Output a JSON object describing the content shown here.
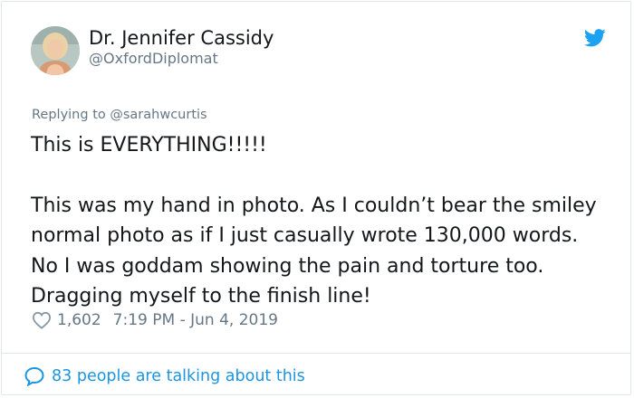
{
  "author": {
    "name": "Dr. Jennifer Cassidy",
    "handle": "@OxfordDiplomat"
  },
  "icons": {
    "brand": "twitter-bird-icon",
    "like": "heart-icon",
    "conversation": "speech-bubble-icon"
  },
  "colors": {
    "brand": "#1da1f2",
    "link": "#1b95e0",
    "secondary_text": "#657786",
    "border": "#e1e8ed"
  },
  "reply": {
    "prefix": "Replying to",
    "mention": "@sarahwcurtis"
  },
  "tweet": {
    "line1": "This is EVERYTHING!!!!!",
    "line2": "This was my hand in photo. As I couldn’t bear the smiley normal photo as if I just casually wrote 130,000 words. No I was goddam showing the pain and torture too. Dragging myself to the finish line!"
  },
  "meta": {
    "likes": "1,602",
    "timestamp": "7:19 PM - Jun 4, 2019"
  },
  "footer": {
    "conversation_text": "83 people are talking about this"
  }
}
